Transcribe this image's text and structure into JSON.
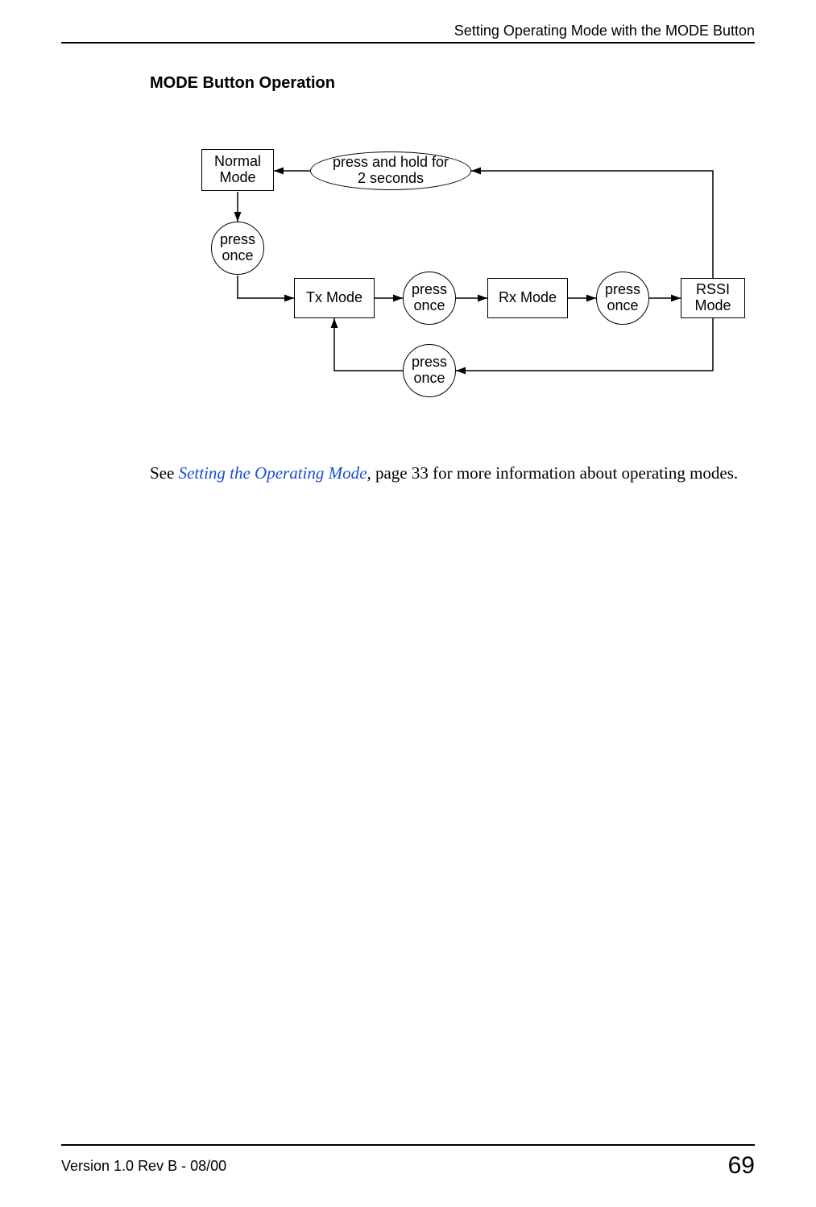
{
  "header": {
    "running_title": "Setting Operating Mode with the MODE Button"
  },
  "section": {
    "title": "MODE Button Operation"
  },
  "diagram": {
    "nodes": {
      "normal_mode": "Normal\nMode",
      "press_hold": "press and hold for\n2 seconds",
      "press_once_1": "press\nonce",
      "tx_mode": "Tx Mode",
      "press_once_2": "press\nonce",
      "rx_mode": "Rx Mode",
      "press_once_3": "press\nonce",
      "rssi_mode": "RSSI\nMode",
      "press_once_4": "press\nonce"
    }
  },
  "body": {
    "see_prefix": "See ",
    "link_text": "Setting the Operating Mode",
    "see_suffix": ", page 33 for more information about operating modes."
  },
  "footer": {
    "version": "Version 1.0 Rev B - 08/00",
    "page_number": "69"
  }
}
